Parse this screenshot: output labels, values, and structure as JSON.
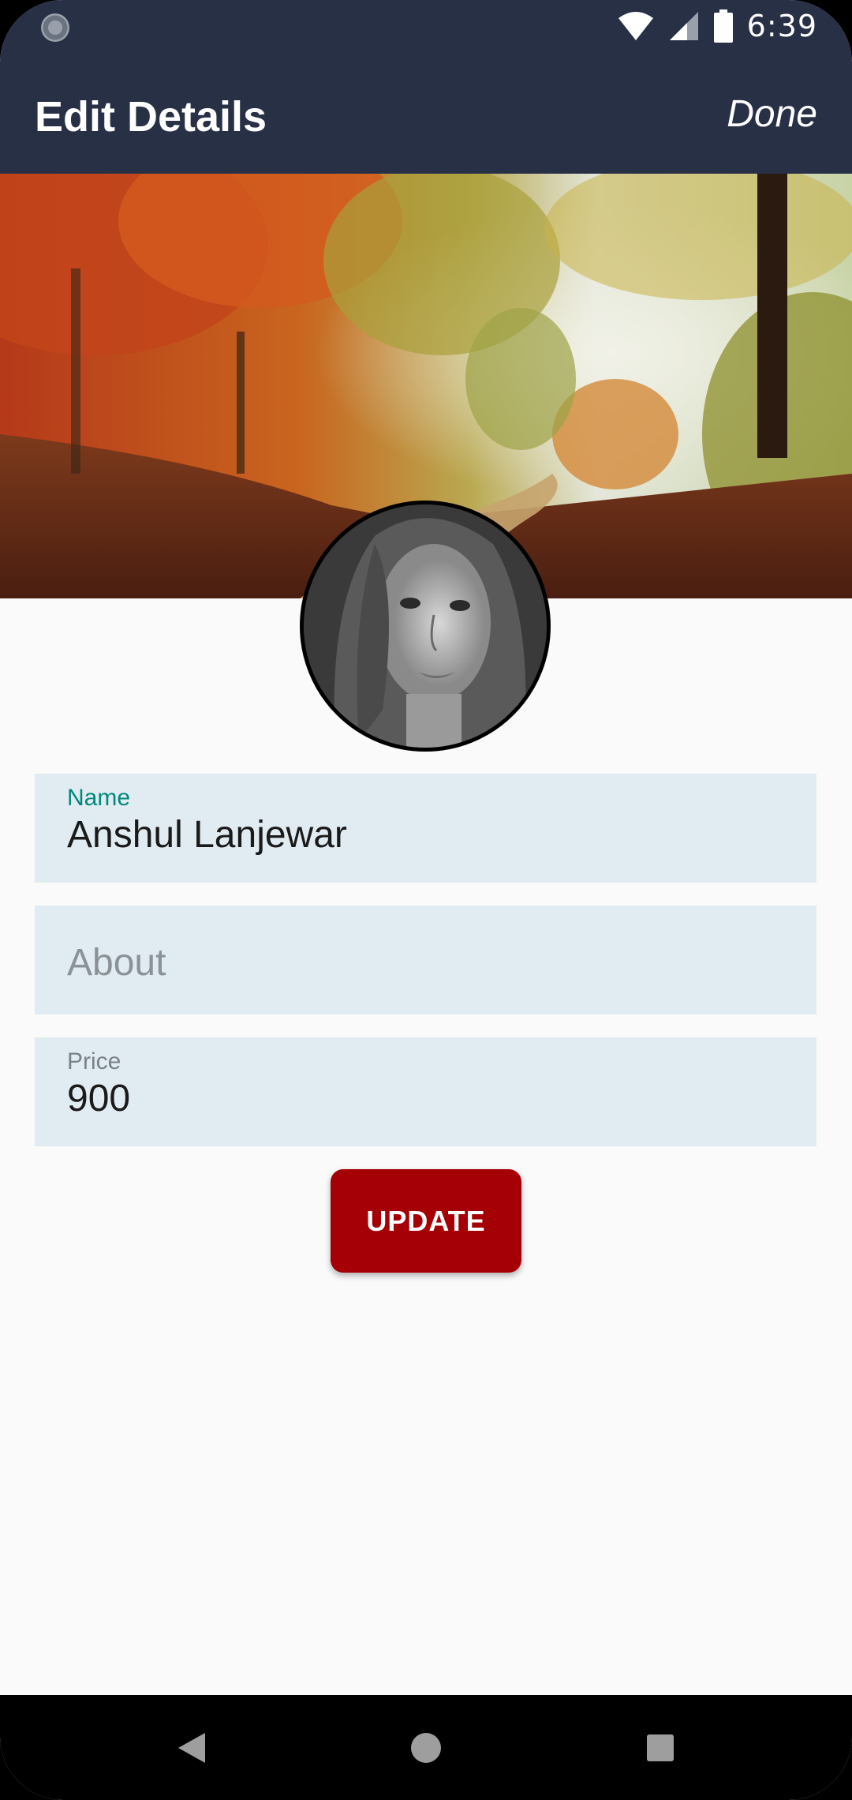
{
  "status_bar": {
    "time": "6:39",
    "icons": [
      "sync-icon",
      "wifi-icon",
      "signal-icon",
      "battery-icon"
    ]
  },
  "app_bar": {
    "title": "Edit Details",
    "done_label": "Done"
  },
  "form": {
    "name": {
      "label": "Name",
      "value": "Anshul Lanjewar"
    },
    "about": {
      "placeholder": "About",
      "value": ""
    },
    "price": {
      "label": "Price",
      "value": "900"
    }
  },
  "update_button_label": "UPDATE",
  "nav_bar": {
    "icons": [
      "back-icon",
      "home-icon",
      "recents-icon"
    ]
  },
  "colors": {
    "app_bar": "#283046",
    "field_background": "#e1ecf2",
    "name_label": "#00897b",
    "price_label": "#7a8288",
    "update_button": "#a50005"
  }
}
